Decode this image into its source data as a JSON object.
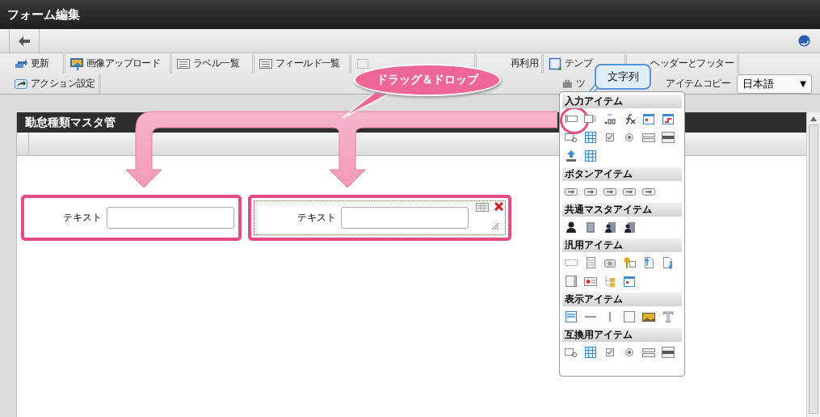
{
  "window": {
    "title": "フォーム編集"
  },
  "toolbar": {
    "rows": [
      {
        "items": [
          {
            "kind": "update",
            "label": "更新"
          },
          {
            "kind": "image-upload",
            "label": "画像アップロード"
          },
          {
            "kind": "list",
            "label": "ラベル一覧"
          },
          {
            "kind": "list",
            "label": "フィールド一覧"
          },
          {
            "kind": "dotted-grid"
          },
          {
            "kind": "none",
            "label": "再利用"
          },
          {
            "kind": "template",
            "label": "テンプ"
          },
          {
            "kind": "none",
            "label": "ヘッダーとフッター"
          }
        ]
      },
      {
        "items": [
          {
            "kind": "action",
            "label": "アクション設定"
          }
        ]
      }
    ],
    "right_items": [
      {
        "kind": "toolbox",
        "label": "ツ"
      },
      {
        "kind": "none",
        "label": "アイテムコピー"
      }
    ],
    "language": {
      "value": "日本語",
      "caret": "▼"
    }
  },
  "form": {
    "title": "勤怠種類マスタ管",
    "fields": [
      {
        "label": "テキスト",
        "selected": false
      },
      {
        "label": "テキスト",
        "selected": true
      }
    ]
  },
  "palette": {
    "sections": [
      {
        "title": "入力アイテム",
        "items": [
          {
            "kind": "text-field",
            "selected": true
          },
          {
            "kind": "spinner",
            "selected": false
          },
          {
            "kind": "decimal",
            "selected": false
          },
          {
            "kind": "function",
            "selected": false
          },
          {
            "kind": "calendar",
            "selected": false
          },
          {
            "kind": "calendar-range",
            "selected": false
          },
          {
            "kind": "search-window",
            "selected": false
          },
          {
            "kind": "grid",
            "selected": false
          },
          {
            "kind": "checkbox",
            "selected": false
          },
          {
            "kind": "radio",
            "selected": false
          },
          {
            "kind": "list",
            "selected": false
          },
          {
            "kind": "list-box",
            "selected": false
          },
          {
            "kind": "upload",
            "selected": false
          },
          {
            "kind": "grid",
            "selected": false
          }
        ]
      },
      {
        "title": "ボタンアイテム",
        "items": [
          {
            "kind": "button",
            "selected": false
          },
          {
            "kind": "button",
            "selected": false
          },
          {
            "kind": "button",
            "selected": false
          },
          {
            "kind": "button",
            "selected": false
          },
          {
            "kind": "button",
            "selected": false
          }
        ]
      },
      {
        "title": "共通マスタアイテム",
        "items": [
          {
            "kind": "user",
            "selected": false
          },
          {
            "kind": "building",
            "selected": false
          },
          {
            "kind": "user-building",
            "selected": false
          },
          {
            "kind": "user-building",
            "selected": false
          }
        ]
      },
      {
        "title": "汎用アイテム",
        "items": [
          {
            "kind": "dashed-box",
            "selected": false
          },
          {
            "kind": "document",
            "selected": false
          },
          {
            "kind": "camera",
            "selected": false
          },
          {
            "kind": "key",
            "selected": false
          },
          {
            "kind": "file-upload",
            "selected": false
          },
          {
            "kind": "file-download",
            "selected": false
          },
          {
            "kind": "panel",
            "selected": false
          },
          {
            "kind": "card",
            "selected": false
          },
          {
            "kind": "tree",
            "selected": false
          },
          {
            "kind": "calendar",
            "selected": false
          }
        ]
      },
      {
        "title": "表示アイテム",
        "items": [
          {
            "kind": "label",
            "selected": false
          },
          {
            "kind": "horizontal-line",
            "selected": false
          },
          {
            "kind": "vertical-line",
            "selected": false
          },
          {
            "kind": "blank",
            "selected": false
          },
          {
            "kind": "image",
            "selected": false
          },
          {
            "kind": "text-style",
            "selected": false
          }
        ]
      },
      {
        "title": "互換用アイテム",
        "items": [
          {
            "kind": "search-window",
            "selected": false
          },
          {
            "kind": "grid",
            "selected": false
          },
          {
            "kind": "checkbox",
            "selected": false
          },
          {
            "kind": "radio",
            "selected": false
          },
          {
            "kind": "list",
            "selected": false
          },
          {
            "kind": "list-box",
            "selected": false
          }
        ]
      }
    ]
  },
  "callouts": [
    {
      "kind": "pink",
      "text": "ドラッグ＆ドロップ"
    },
    {
      "kind": "blue",
      "text": "文字列"
    }
  ]
}
